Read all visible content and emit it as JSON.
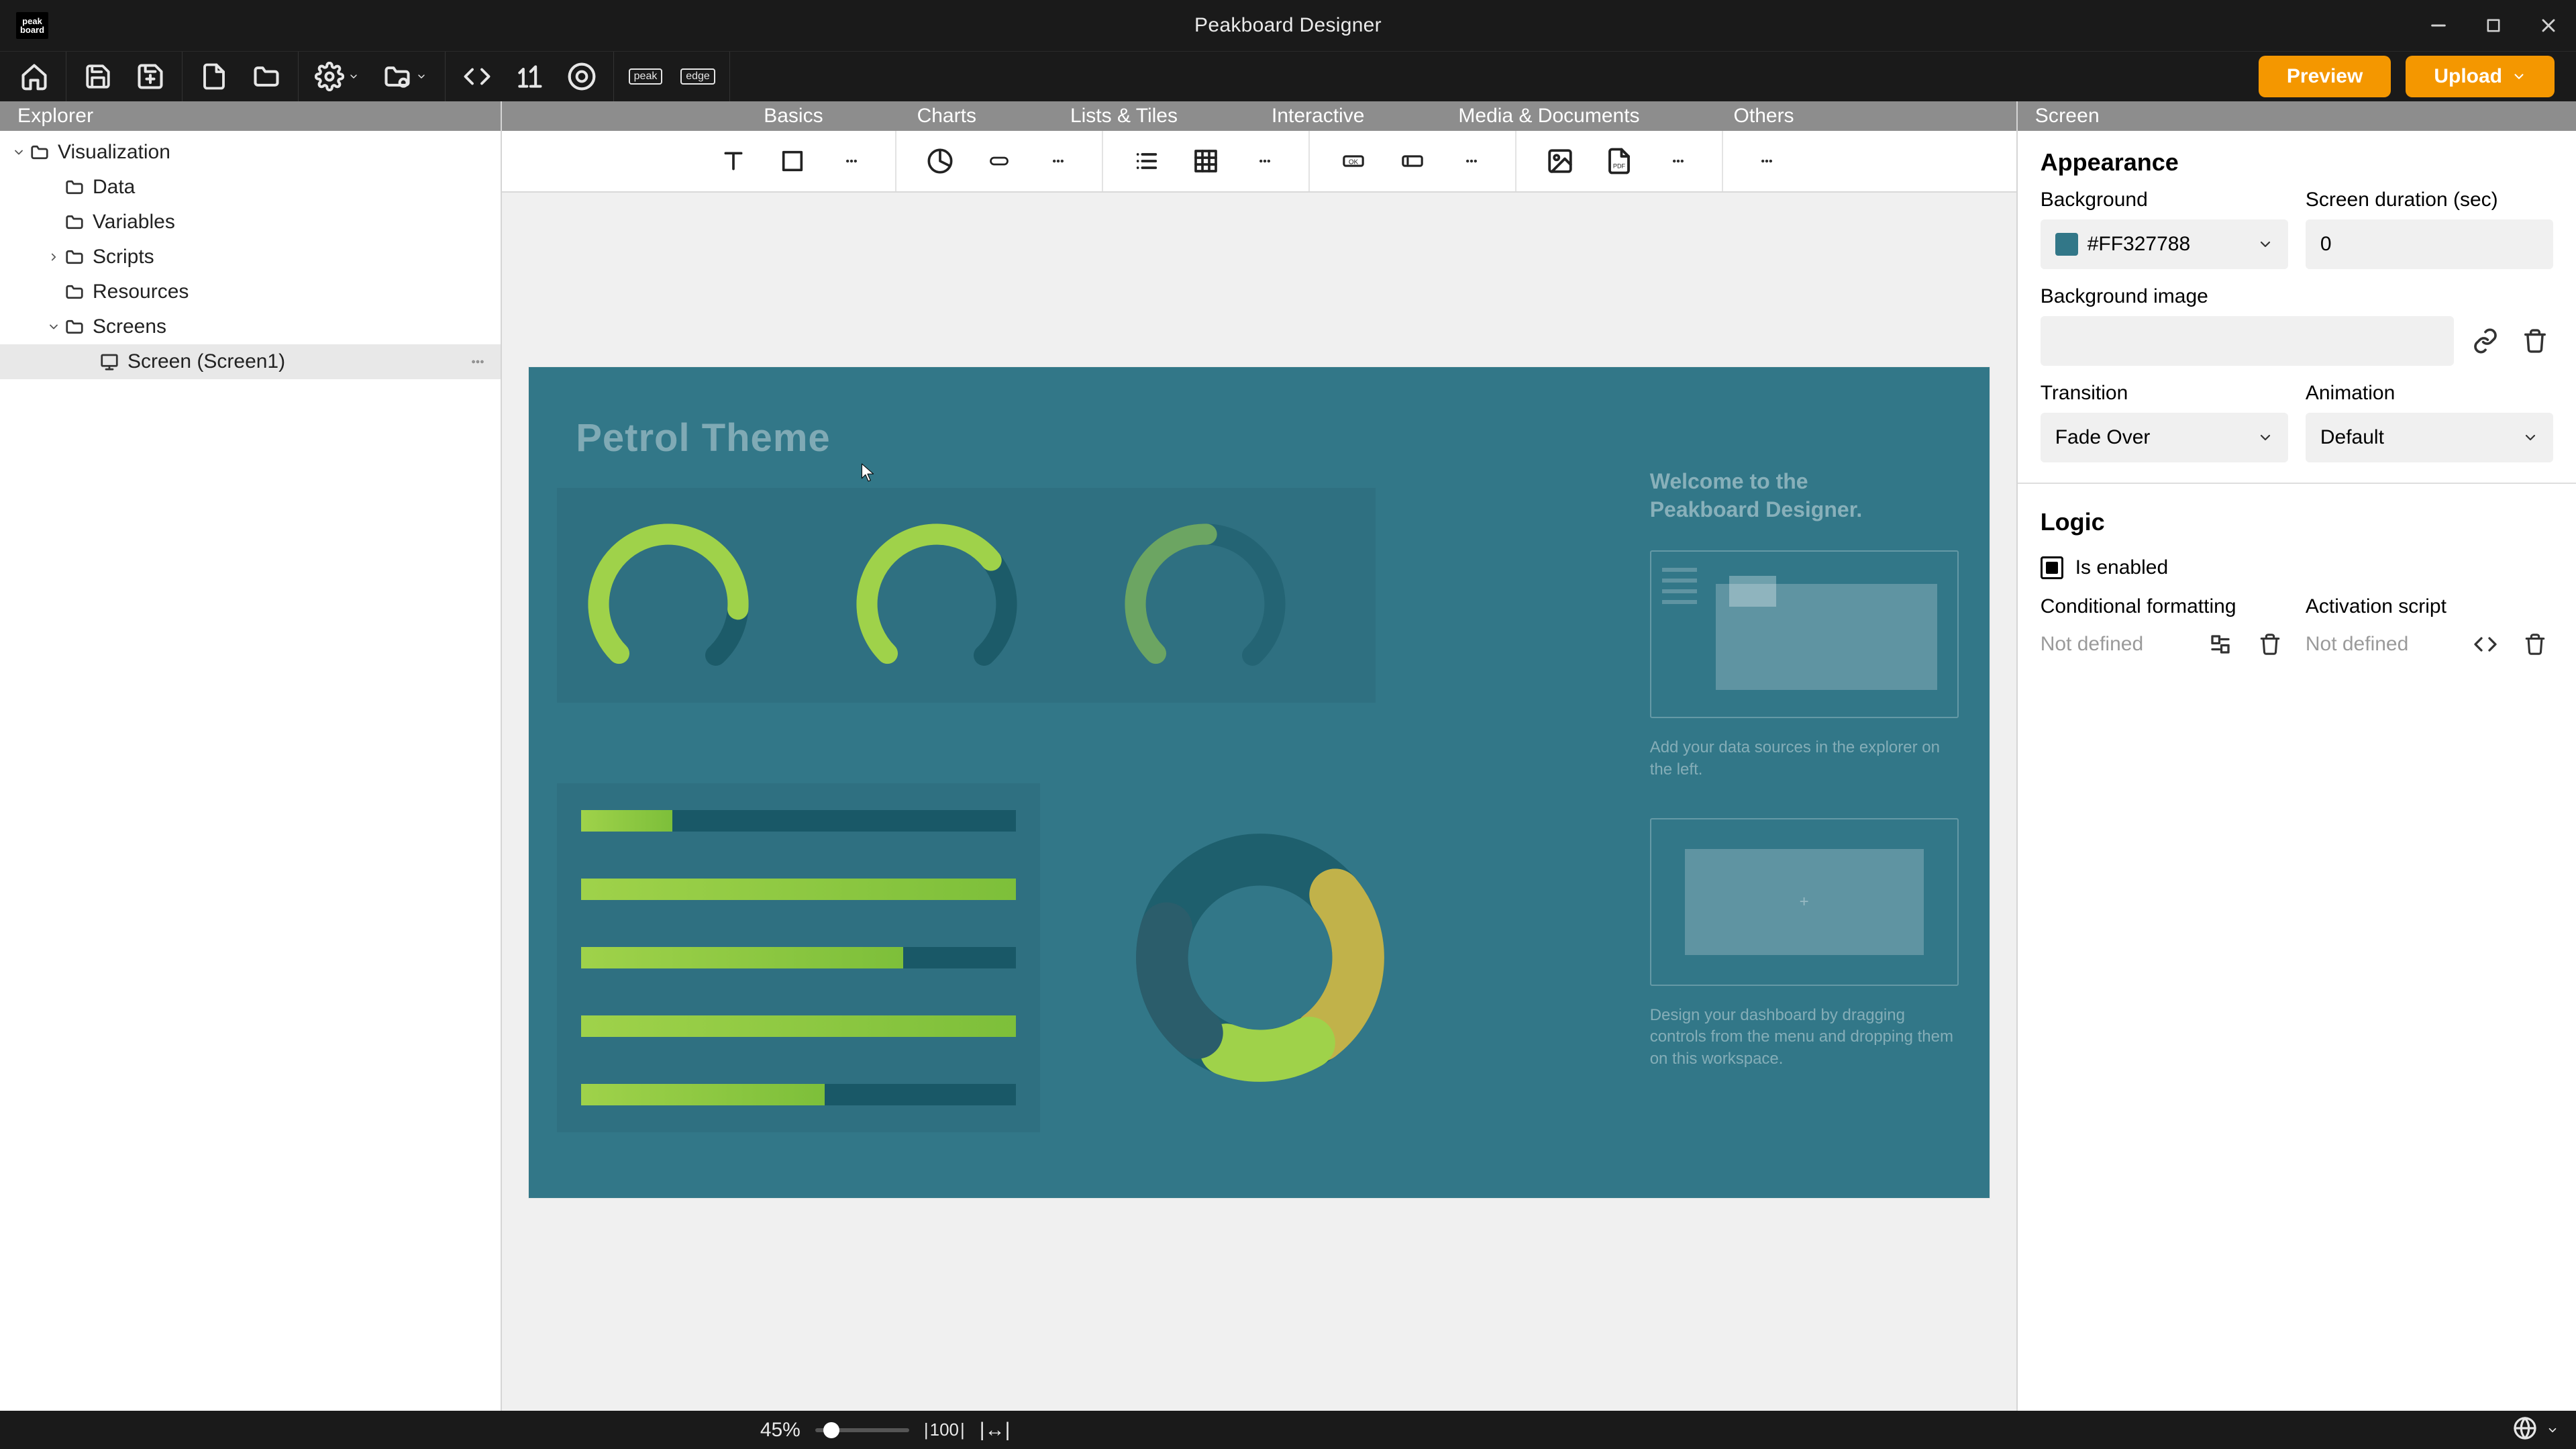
{
  "app_title": "Peakboard Designer",
  "logo_text": "peak board",
  "toolbar": {
    "preview": "Preview",
    "upload": "Upload",
    "badge_peak": "peak",
    "badge_edge": "edge"
  },
  "explorer": {
    "header": "Explorer",
    "tree": {
      "root": "Visualization",
      "data": "Data",
      "variables": "Variables",
      "scripts": "Scripts",
      "resources": "Resources",
      "screens": "Screens",
      "screen1": "Screen (Screen1)"
    }
  },
  "controls_tabs": {
    "basics": "Basics",
    "charts": "Charts",
    "lists": "Lists & Tiles",
    "interactive": "Interactive",
    "media": "Media & Documents",
    "others": "Others"
  },
  "stage": {
    "title": "Petrol Theme",
    "welcome_l1": "Welcome to the",
    "welcome_l2": "Peakboard Designer.",
    "tip1": "Add your data sources in the explorer on the left.",
    "tip2": "Design your dashboard by dragging controls from the menu and dropping them on this workspace."
  },
  "inspector": {
    "header": "Screen",
    "appearance": "Appearance",
    "background_label": "Background",
    "background_value": "#FF327788",
    "duration_label": "Screen duration (sec)",
    "duration_value": "0",
    "bg_image_label": "Background image",
    "transition_label": "Transition",
    "transition_value": "Fade Over",
    "animation_label": "Animation",
    "animation_value": "Default",
    "logic": "Logic",
    "is_enabled": "Is enabled",
    "cond_fmt_label": "Conditional formatting",
    "cond_fmt_value": "Not defined",
    "activation_label": "Activation script",
    "activation_value": "Not defined"
  },
  "status": {
    "zoom": "45%",
    "fit100": "100",
    "fitw": "↔"
  }
}
